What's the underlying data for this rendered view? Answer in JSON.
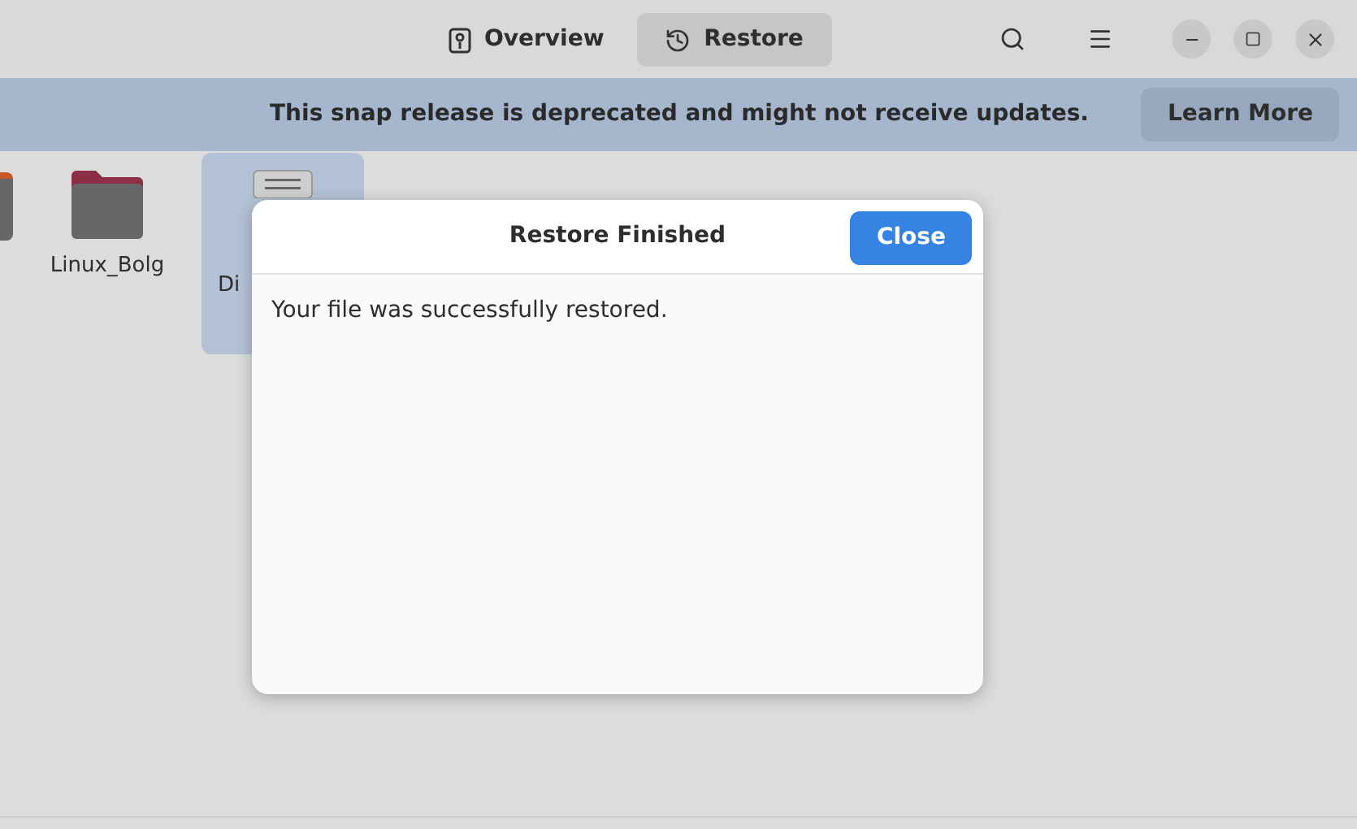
{
  "header": {
    "tabs": [
      {
        "label": "Overview",
        "kind": "overview",
        "selected": false
      },
      {
        "label": "Restore",
        "kind": "restore",
        "selected": true
      }
    ]
  },
  "banner": {
    "message": "This snap release is deprecated and might not receive updates.",
    "button": "Learn More"
  },
  "files": [
    {
      "label": "Linux_Bolg",
      "kind": "folder",
      "selected": false
    },
    {
      "label": "Di",
      "kind": "binary",
      "selected": true
    }
  ],
  "dialog": {
    "title": "Restore Finished",
    "button": "Close",
    "message": "Your file was successfully restored."
  }
}
